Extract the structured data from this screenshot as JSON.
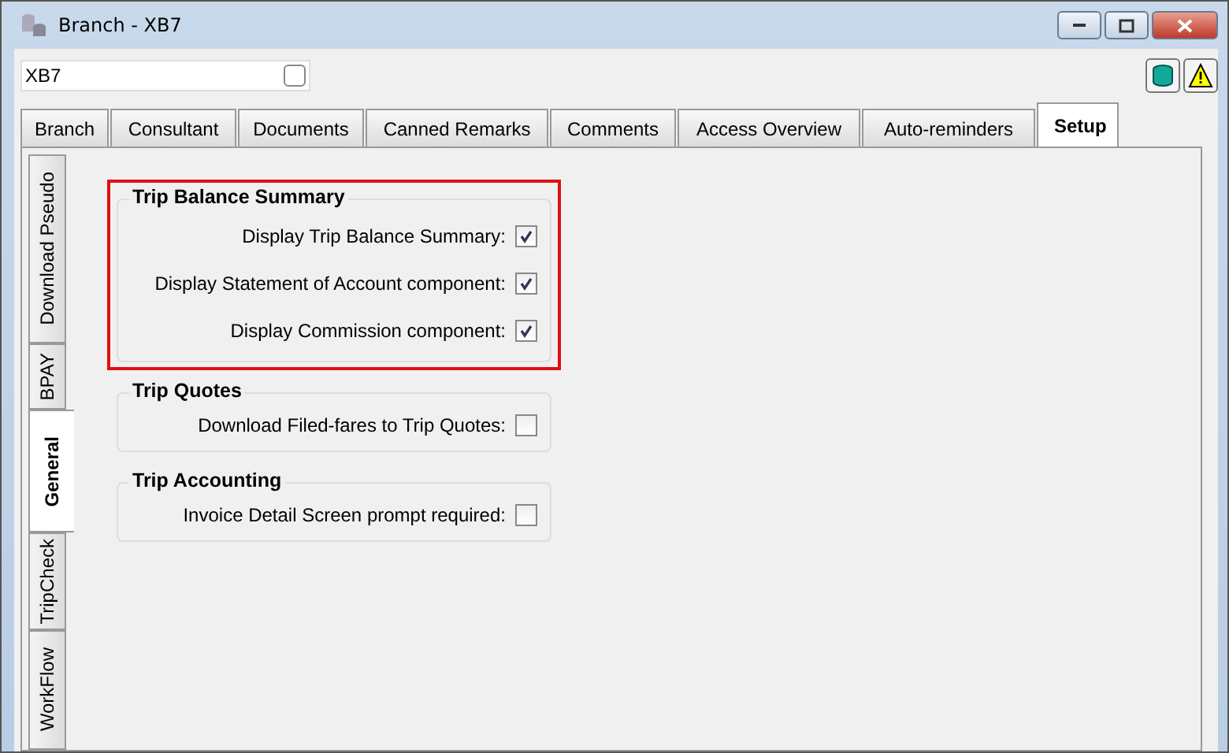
{
  "window": {
    "title": "Branch - XB7"
  },
  "record_field": {
    "value": "XB7",
    "checked": false
  },
  "tabs": [
    {
      "label": "Branch",
      "selected": false
    },
    {
      "label": "Consultant",
      "selected": false
    },
    {
      "label": "Documents",
      "selected": false
    },
    {
      "label": "Canned Remarks",
      "selected": false
    },
    {
      "label": "Comments",
      "selected": false
    },
    {
      "label": "Access Overview",
      "selected": false
    },
    {
      "label": "Auto-reminders",
      "selected": false
    },
    {
      "label": "Setup",
      "selected": true
    }
  ],
  "side_tabs": [
    {
      "label": "Download Pseudo",
      "selected": false
    },
    {
      "label": "BPAY",
      "selected": false
    },
    {
      "label": "General",
      "selected": true
    },
    {
      "label": "TripCheck",
      "selected": false
    },
    {
      "label": "WorkFlow",
      "selected": false
    }
  ],
  "groups": [
    {
      "title": "Trip Balance Summary",
      "highlighted": true,
      "options": [
        {
          "label": "Display Trip Balance Summary:",
          "checked": true
        },
        {
          "label": "Display Statement of Account component:",
          "checked": true
        },
        {
          "label": "Display Commission component:",
          "checked": true
        }
      ]
    },
    {
      "title": "Trip Quotes",
      "highlighted": false,
      "options": [
        {
          "label": "Download Filed-fares to Trip Quotes:",
          "checked": false
        }
      ]
    },
    {
      "title": "Trip Accounting",
      "highlighted": false,
      "options": [
        {
          "label": "Invoice Detail Screen prompt required:",
          "checked": false
        }
      ]
    }
  ]
}
